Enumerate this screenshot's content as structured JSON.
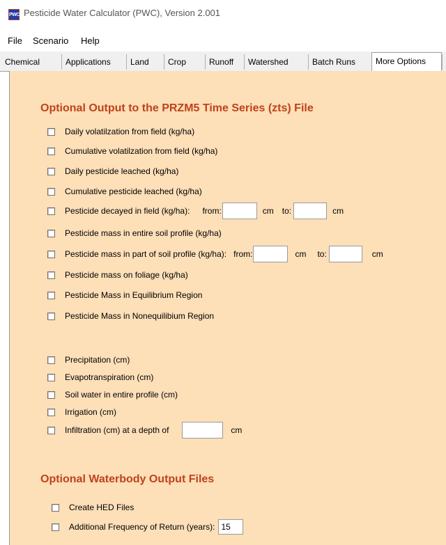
{
  "window": {
    "title": "Pesticide Water Calculator (PWC), Version 2.001",
    "icon_text": "PWC"
  },
  "menu": [
    "File",
    "Scenario",
    "Help"
  ],
  "tabs": [
    "Chemical",
    "Applications",
    "Land",
    "Crop",
    "Runoff",
    "Watershed",
    "Batch Runs",
    "More Options"
  ],
  "active_tab": "More Options",
  "zts_section": {
    "title": "Optional Output to the PRZM5 Time Series (zts) File",
    "items": [
      "Daily volatilzation from field (kg/ha)",
      "Cumulative volatilzation from field (kg/ha)",
      "Daily pesticide leached (kg/ha)",
      "Cumulative pesticide leached (kg/ha)",
      "Pesticide decayed in field (kg/ha):",
      "Pesticide mass in entire soil profile (kg/ha)",
      "Pesticide mass in part of soil profile (kg/ha):",
      "Pesticide mass on foliage (kg/ha)",
      "Pesticide Mass in Equilibrium Region",
      "Pesticide Mass in Nonequilibium Region",
      "Precipitation (cm)",
      "Evapotranspiration (cm)",
      "Soil water in entire profile (cm)",
      "Irrigation (cm)",
      "Infiltration (cm) at a depth of"
    ],
    "from_label": "from:",
    "to_label": "to:",
    "unit_cm": "cm",
    "decay_from": "",
    "decay_to": "",
    "part_from": "",
    "part_to": "",
    "infiltration_depth": ""
  },
  "waterbody_section": {
    "title": "Optional Waterbody Output Files",
    "create_hed_label": "Create HED Files",
    "freq_label": "Additional Frequency of Return (years):",
    "freq_value": "15"
  },
  "colors": {
    "panel_bg": "#fddfb8",
    "section_title": "#c0421a"
  }
}
